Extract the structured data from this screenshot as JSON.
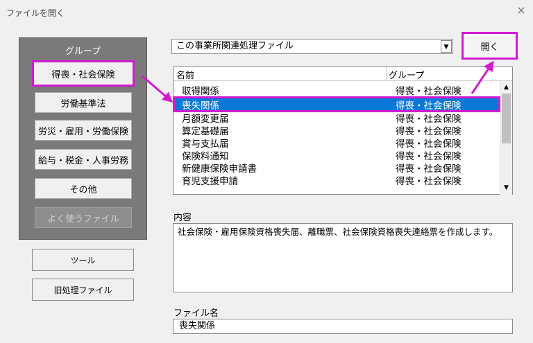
{
  "window": {
    "title": "ファイルを開く",
    "close_icon": "×"
  },
  "group_panel": {
    "title": "グループ",
    "buttons": [
      {
        "label": "得喪・社会保険",
        "highlighted": true
      },
      {
        "label": "労働基準法"
      },
      {
        "label": "労災・雇用・労働保険"
      },
      {
        "label": "給与・税金・人事労務"
      },
      {
        "label": "その他"
      },
      {
        "label": "よく使うファイル",
        "disabled": true
      }
    ]
  },
  "tools": {
    "tool_label": "ツール",
    "old_files_label": "旧処理ファイル"
  },
  "combo": {
    "value": "この事業所関連処理ファイル",
    "arrow": "▼"
  },
  "open_button": {
    "label": "開く"
  },
  "list": {
    "headers": [
      "名前",
      "グループ"
    ],
    "rows": [
      {
        "name": "取得関係",
        "group": "得喪・社会保険"
      },
      {
        "name": "喪失関係",
        "group": "得喪・社会保険",
        "selected": true
      },
      {
        "name": "月額変更届",
        "group": "得喪・社会保険"
      },
      {
        "name": "算定基礎届",
        "group": "得喪・社会保険"
      },
      {
        "name": "賞与支払届",
        "group": "得喪・社会保険"
      },
      {
        "name": "保険料通知",
        "group": "得喪・社会保険"
      },
      {
        "name": "新健康保険申請書",
        "group": "得喪・社会保険"
      },
      {
        "name": "育児支援申請",
        "group": "得喪・社会保険"
      }
    ],
    "scroll_up": "▲",
    "scroll_down": "▼"
  },
  "content": {
    "label": "内容",
    "text": "社会保険・雇用保険資格喪失届、離職票、社会保険資格喪失連絡票を作成します。"
  },
  "file_name": {
    "label": "ファイル名",
    "value": "喪失関係"
  },
  "colors": {
    "highlight": "#d01ad0",
    "selection": "#0a78d7"
  }
}
